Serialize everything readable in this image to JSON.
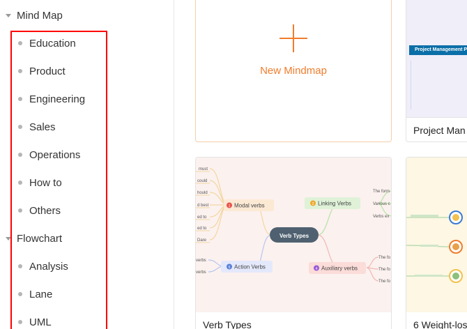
{
  "sidebar": {
    "categories": [
      {
        "label": "Mind Map",
        "items": [
          "Education",
          "Product",
          "Engineering",
          "Sales",
          "Operations",
          "How to",
          "Others"
        ]
      },
      {
        "label": "Flowchart",
        "items": [
          "Analysis",
          "Lane",
          "UML"
        ]
      }
    ]
  },
  "cards": {
    "new_mindmap": {
      "label": "New Mindmap",
      "icon": "plus-icon",
      "accent": "#f07c2d"
    },
    "project_management": {
      "title": "Project Man",
      "thumb_banner": "Project Management Plan"
    },
    "verb_types": {
      "title": "Verb Types",
      "center": "Verb Types",
      "branches": [
        {
          "label": "Modal verbs",
          "number": "1",
          "color": "#e8524a"
        },
        {
          "label": "Action Verbs",
          "number": "5",
          "color": "#5a7fd8"
        },
        {
          "label": "Linking Verbs",
          "number": "2",
          "color": "#f0a92d"
        },
        {
          "label": "Auxiliary verbs",
          "number": "4",
          "color": "#9a5ad8"
        }
      ],
      "modal_leaves": [
        "must",
        "could",
        "hould",
        "d best",
        "ed to",
        "ed to",
        "Dare"
      ],
      "action_leaves": [
        "verbs",
        "verbs"
      ],
      "linking_leaves": [
        "The form",
        "Various c",
        "Verbs ex"
      ],
      "auxiliary_leaves": [
        "The fo",
        "The fo",
        "The fo"
      ]
    },
    "weight_loss": {
      "title": "6 Weight-los"
    }
  }
}
